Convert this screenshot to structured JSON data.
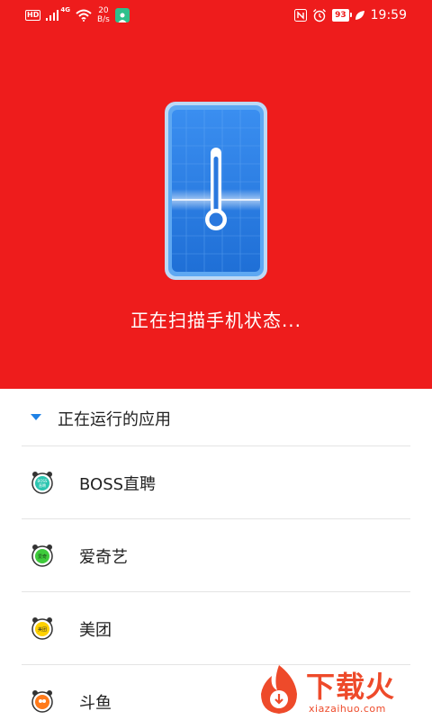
{
  "status_bar": {
    "hd": "HD",
    "network": "4G",
    "speed_value": "20",
    "speed_unit": "B/s",
    "battery": "93",
    "time": "19:59"
  },
  "hero": {
    "background": "#ee1c1c",
    "scan_text": "正在扫描手机状态..."
  },
  "section": {
    "title": "正在运行的应用"
  },
  "apps": [
    {
      "name": "BOSS直聘",
      "icon": "boss-app-icon",
      "badge": "BOSS\n直聘",
      "badge_color": "#2bc5b0"
    },
    {
      "name": "爱奇艺",
      "icon": "iqiyi-app-icon",
      "badge": "爱奇",
      "badge_color": "#3ecb3b"
    },
    {
      "name": "美团",
      "icon": "meituan-app-icon",
      "badge": "美团",
      "badge_color": "#ffd100"
    },
    {
      "name": "斗鱼",
      "icon": "douyu-app-icon",
      "badge": "",
      "badge_color": "#ff7a1a"
    }
  ],
  "watermark": {
    "cn": "下载火",
    "en": "xiazaihuo.com",
    "color": "#ee4a2a"
  }
}
